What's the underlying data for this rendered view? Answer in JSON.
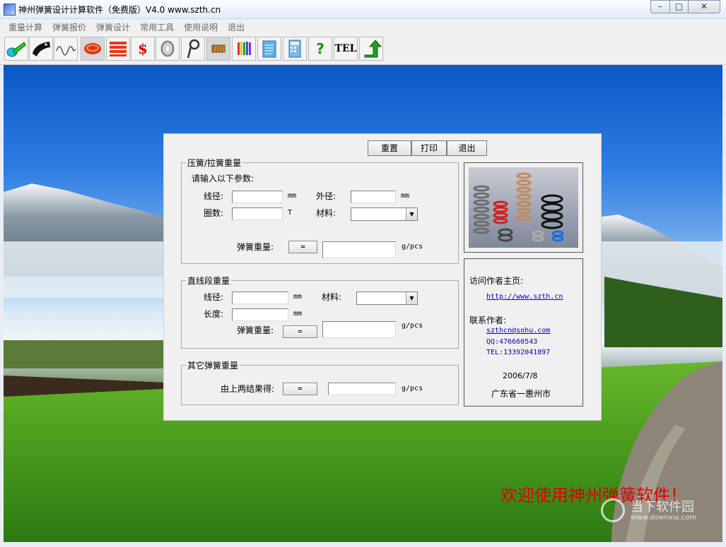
{
  "window": {
    "title": "神州弹簧设计计算软件（免费版）V4.0 www.szth.cn",
    "min": "–",
    "max": "□",
    "close": "✕"
  },
  "menu": [
    "重量计算",
    "弹簧报价",
    "弹簧设计",
    "常用工具",
    "使用说明",
    "退出"
  ],
  "toolbar": {
    "icons": [
      "compression-spring-icon",
      "extension-spring-icon",
      "wave-spring-icon",
      "red-coil-icon",
      "red-stack-icon",
      "price-icon",
      "wire-icon",
      "torsion-spring-icon",
      "spring-settings-icon",
      "pencils-icon",
      "notepad-icon",
      "calculator-icon",
      "help-icon",
      "tel-icon",
      "exit-icon"
    ],
    "price_symbol": "$",
    "help_symbol": "?",
    "tel_label": "TEL"
  },
  "panel": {
    "buttons": {
      "reset": "重置",
      "print": "打印",
      "exit": "退出"
    },
    "group1": {
      "legend": "压簧/拉簧重量",
      "prompt": "请输入以下参数:",
      "wire_label": "线径:",
      "wire_unit": "mm",
      "od_label": "外径:",
      "od_unit": "mm",
      "coils_label": "圈数:",
      "coils_unit": "T",
      "material_label": "材料:",
      "weight_label": "弹簧重量:",
      "eq": "=",
      "weight_unit": "g/pcs"
    },
    "group2": {
      "legend": "直线段重量",
      "wire_label": "线径:",
      "wire_unit": "mm",
      "material_label": "材料:",
      "length_label": "长度:",
      "length_unit": "mm",
      "weight_label": "弹簧重量:",
      "eq": "=",
      "weight_unit": "g/pcs"
    },
    "group3": {
      "legend": "其它弹簧重量",
      "result_label": "由上两结果得:",
      "eq": "=",
      "weight_unit": "g/pcs"
    },
    "info": {
      "homepage_label": "访问作者主页:",
      "homepage_url": "http://www.szth.cn",
      "contact_label": "联系作者:",
      "email": "szthcn@sohu.com",
      "qq": "QQ:476660543",
      "tel": "TEL:13392041897",
      "date": "2006/7/8",
      "location": "广东省一惠州市"
    }
  },
  "welcome": "欢迎使用神州弹簧软件！",
  "watermark": {
    "brand": "当下软件园",
    "url": "www.downxia.com"
  }
}
